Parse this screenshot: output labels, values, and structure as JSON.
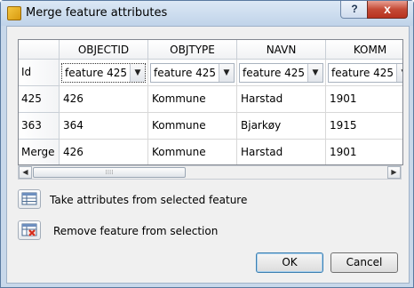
{
  "window": {
    "title": "Merge feature attributes",
    "help_label": "?",
    "close_label": "x"
  },
  "table": {
    "corner": "",
    "columns": [
      "OBJECTID",
      "OBJTYPE",
      "NAVN",
      "KOMM"
    ],
    "id_row": {
      "header": "Id",
      "selections": [
        "feature 425",
        "feature 425",
        "feature 425",
        "feature 425"
      ]
    },
    "rows": [
      {
        "header": "425",
        "cells": [
          "426",
          "Kommune",
          "Harstad",
          "1901"
        ]
      },
      {
        "header": "363",
        "cells": [
          "364",
          "Kommune",
          "Bjarkøy",
          "1915"
        ]
      },
      {
        "header": "Merge",
        "cells": [
          "426",
          "Kommune",
          "Harstad",
          "1901"
        ]
      }
    ]
  },
  "scrollbar": {
    "left_arrow": "◀",
    "right_arrow": "▶",
    "grip": "⁞⁞⁞⁞"
  },
  "actions": {
    "take_attributes_label": "Take attributes from selected feature",
    "remove_feature_label": "Remove feature from selection"
  },
  "buttons": {
    "ok": "OK",
    "cancel": "Cancel"
  },
  "icons": {
    "combo_arrow": "▼"
  }
}
